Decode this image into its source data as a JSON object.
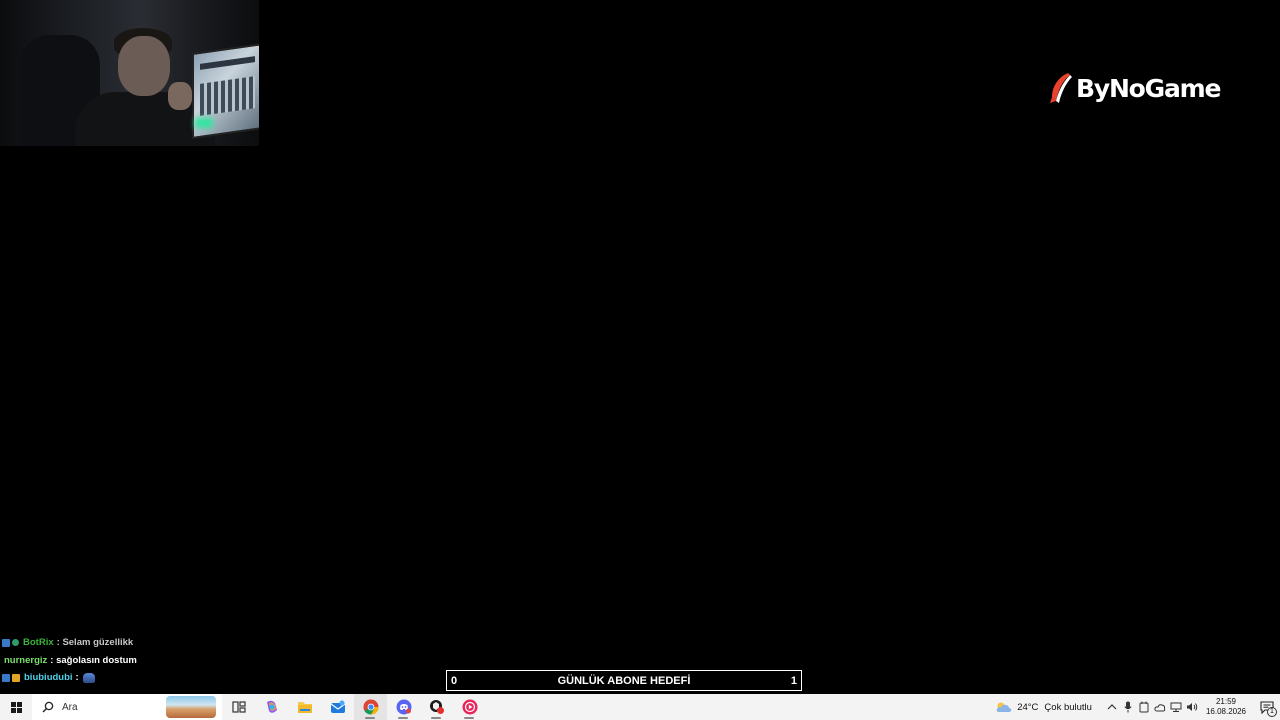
{
  "overlay": {
    "brand": "ByNoGame",
    "brand_accent_color": "#e8412c"
  },
  "chat": [
    {
      "user": "BotRix",
      "user_color": "#3cb43c",
      "message": "Selam güzellikk",
      "message_color": "#c8c8c8",
      "badges": [
        "b1",
        "b2"
      ]
    },
    {
      "user": "nurnergiz",
      "user_color": "#7be06b",
      "message": "sağolasın dostum",
      "message_color": "#ffffff",
      "badges": []
    },
    {
      "user": "biubiudubi",
      "user_color": "#4fd1e8",
      "message": "",
      "message_color": "#ffffff",
      "badges": [
        "b1",
        "b3"
      ],
      "emote": true
    }
  ],
  "goal": {
    "min": "0",
    "title": "GÜNLÜK ABONE HEDEFİ",
    "max": "1"
  },
  "taskbar": {
    "search_placeholder": "Ara",
    "apps": [
      {
        "name": "task-view-icon",
        "running": false
      },
      {
        "name": "copilot-icon",
        "running": false
      },
      {
        "name": "file-explorer-icon",
        "running": false
      },
      {
        "name": "mail-icon",
        "running": false
      },
      {
        "name": "chrome-icon",
        "running": true,
        "active": true
      },
      {
        "name": "discord-icon",
        "running": true
      },
      {
        "name": "app-red-icon",
        "running": true
      },
      {
        "name": "media-player-icon",
        "running": true
      }
    ],
    "weather": {
      "temp": "24°C",
      "condition": "Çok bulutlu"
    },
    "time": "21:59",
    "date": "16.08.2026",
    "notification_count": "1"
  }
}
